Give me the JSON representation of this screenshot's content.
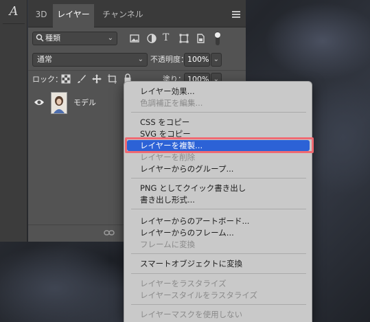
{
  "tool_strip": {
    "character_icon_glyph": "A"
  },
  "panel": {
    "tabs": [
      {
        "label": "3D",
        "active": false
      },
      {
        "label": "レイヤー",
        "active": true
      },
      {
        "label": "チャンネル",
        "active": false
      }
    ],
    "filter": {
      "label": "種類"
    },
    "blend_mode": {
      "value": "通常"
    },
    "opacity": {
      "label": "不透明度：",
      "value": "100%"
    },
    "lock": {
      "label": "ロック："
    },
    "fill": {
      "label": "塗り：",
      "value": "100%"
    },
    "layer": {
      "name": "モデル"
    }
  },
  "context_menu": {
    "items": [
      {
        "label": "レイヤー効果...",
        "disabled": false
      },
      {
        "label": "色調補正を編集...",
        "disabled": true
      },
      {
        "label": "CSS をコピー",
        "disabled": false
      },
      {
        "label": "SVG をコピー",
        "disabled": false
      },
      {
        "label": "レイヤーを複製...",
        "disabled": false,
        "selected": true
      },
      {
        "label": "レイヤーを削除",
        "disabled": true
      },
      {
        "label": "レイヤーからのグループ...",
        "disabled": false
      },
      {
        "label": "PNG としてクイック書き出し",
        "disabled": false
      },
      {
        "label": "書き出し形式...",
        "disabled": false
      },
      {
        "label": "レイヤーからのアートボード...",
        "disabled": false
      },
      {
        "label": "レイヤーからのフレーム...",
        "disabled": false
      },
      {
        "label": "フレームに変換",
        "disabled": true
      },
      {
        "label": "スマートオブジェクトに変換",
        "disabled": false
      },
      {
        "label": "レイヤーをラスタライズ",
        "disabled": true
      },
      {
        "label": "レイヤースタイルをラスタライズ",
        "disabled": true
      },
      {
        "label": "レイヤーマスクを使用しない",
        "disabled": true
      }
    ]
  },
  "colors": {
    "menu_highlight": "#2c62d6",
    "highlight_outline": "#f06a72",
    "panel_bg": "#535353"
  }
}
